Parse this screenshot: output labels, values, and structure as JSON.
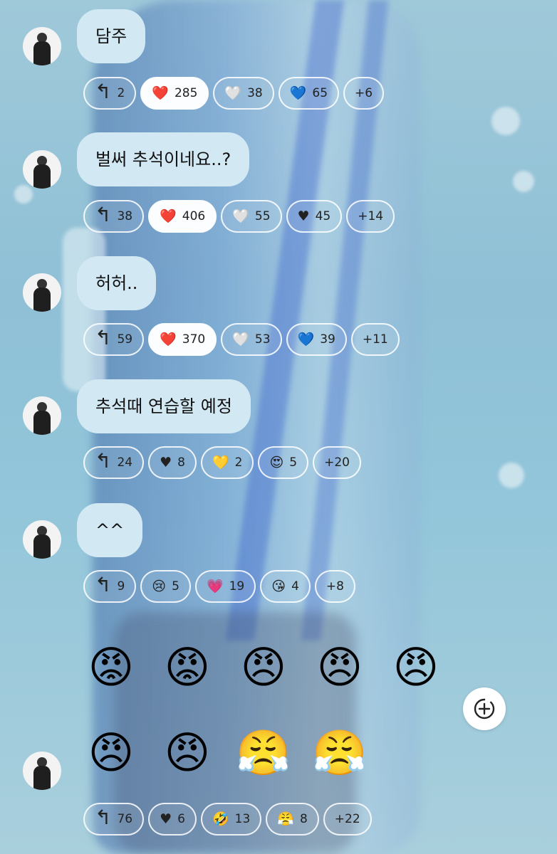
{
  "messages": [
    {
      "text": "담주",
      "reply_count": "2",
      "reactions": [
        {
          "icon": "❤️",
          "icon_name": "red-heart-icon",
          "count": "285",
          "active": true
        },
        {
          "icon": "🤍",
          "icon_name": "white-heart-icon",
          "count": "38"
        },
        {
          "icon": "💙",
          "icon_name": "blue-heart-icon",
          "count": "65"
        }
      ],
      "more": "+6"
    },
    {
      "text": "벌써 추석이네요..?",
      "reply_count": "38",
      "reactions": [
        {
          "icon": "❤️",
          "icon_name": "red-heart-icon",
          "count": "406",
          "active": true
        },
        {
          "icon": "🤍",
          "icon_name": "white-heart-icon",
          "count": "55"
        },
        {
          "icon": "♥",
          "icon_name": "black-heart-icon",
          "count": "45"
        }
      ],
      "more": "+14"
    },
    {
      "text": "허허..",
      "reply_count": "59",
      "reactions": [
        {
          "icon": "❤️",
          "icon_name": "red-heart-icon",
          "count": "370",
          "active": true
        },
        {
          "icon": "🤍",
          "icon_name": "white-heart-icon",
          "count": "53"
        },
        {
          "icon": "💙",
          "icon_name": "blue-heart-icon",
          "count": "39"
        }
      ],
      "more": "+11"
    },
    {
      "text": "추석때 연습할 예정",
      "reply_count": "24",
      "reactions": [
        {
          "icon": "♥",
          "icon_name": "black-heart-icon",
          "count": "8"
        },
        {
          "icon": "💛",
          "icon_name": "yellow-heart-icon",
          "count": "2"
        },
        {
          "icon": "😍",
          "icon_name": "heart-eyes-icon",
          "count": "5"
        }
      ],
      "more": "+20"
    },
    {
      "text": "^^",
      "reply_count": "9",
      "reactions": [
        {
          "icon": "😢",
          "icon_name": "crying-face-icon",
          "count": "5"
        },
        {
          "icon": "💗",
          "icon_name": "pink-heart-icon",
          "count": "19"
        },
        {
          "icon": "😘",
          "icon_name": "kissing-face-icon",
          "count": "4"
        }
      ],
      "more": "+8"
    }
  ],
  "emoji_message": {
    "rows": [
      [
        "😡",
        "😡",
        "😠",
        "😠",
        "😠"
      ],
      [
        "😠",
        "😠",
        "😤",
        "😤"
      ]
    ],
    "reply_count": "76",
    "reactions": [
      {
        "icon": "♥",
        "icon_name": "black-heart-icon",
        "count": "6"
      },
      {
        "icon": "🤣",
        "icon_name": "rolling-laughing-icon",
        "count": "13"
      },
      {
        "icon": "😤",
        "icon_name": "steam-face-icon",
        "count": "8"
      }
    ],
    "more": "+22"
  },
  "colors": {
    "bubble": "#d2e8f3",
    "active_chip": "#fbfdfe"
  }
}
